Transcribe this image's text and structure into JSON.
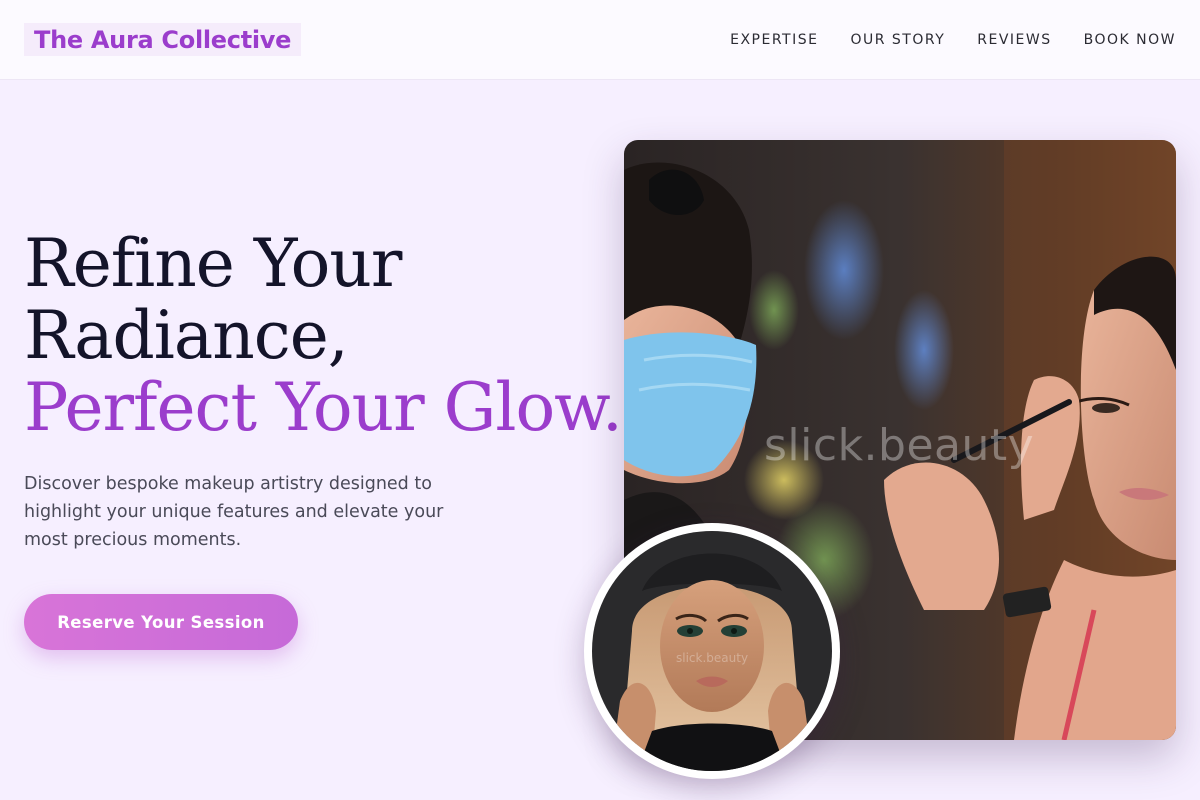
{
  "brand": {
    "name": "The Aura Collective"
  },
  "nav": {
    "items": [
      "EXPERTISE",
      "OUR STORY",
      "REVIEWS",
      "BOOK NOW"
    ]
  },
  "hero": {
    "headline_line1": "Refine Your",
    "headline_line2": "Radiance,",
    "headline_accent": "Perfect Your Glow.",
    "subtext": "Discover bespoke makeup artistry designed to highlight your unique features and elevate your most precious moments.",
    "cta_label": "Reserve Your Session"
  },
  "images": {
    "main_watermark": "slick.beauty",
    "portrait_watermark": "slick.beauty"
  },
  "colors": {
    "accent": "#9b3dcc",
    "background": "#f6efff",
    "cta": "#d270d8",
    "heading": "#14142a"
  }
}
